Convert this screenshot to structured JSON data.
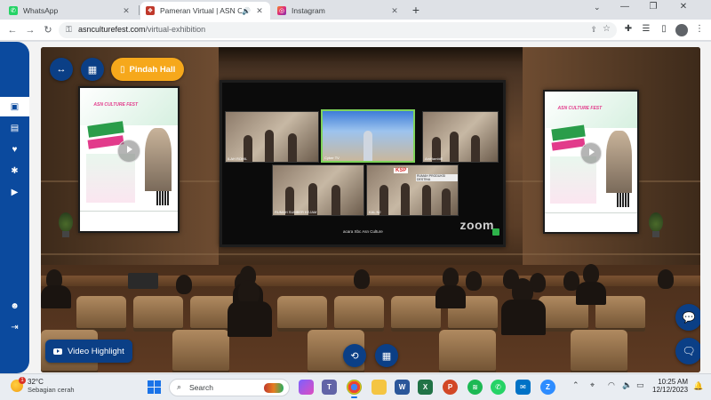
{
  "browser": {
    "tabs": [
      {
        "label": "WhatsApp",
        "favicon_color": "#25d366"
      },
      {
        "label": "Pameran Virtual | ASN Cultu",
        "favicon_color": "#c0392b",
        "active": true
      },
      {
        "label": "Instagram",
        "favicon_color": "#e1306c"
      }
    ],
    "new_tab": "+",
    "url_domain": "asnculturefest.com",
    "url_path": "/virtual-exhibition"
  },
  "exhibition": {
    "pindah_hall_label": "Pindah Hall",
    "video_highlight_label": "Video Highlight",
    "poster_title": "ASN CULTURE FEST",
    "zoom_brand": "zoom",
    "zoom_caption": "acara Xbc Asn Culture",
    "video_tiles": [
      {
        "caption": "ILAH ROHIL"
      },
      {
        "caption": "Cyber TV"
      },
      {
        "caption": "AmHambiE"
      },
      {
        "caption": "RUMAH SUMBER KEJAM"
      },
      {
        "caption": "KAL N2"
      }
    ],
    "tile_signs": [
      "KSP",
      "RUMAH PRODUKSI DESTINA"
    ]
  },
  "sidebar": {
    "items": [
      {
        "name": "exhibition",
        "icon": "store-icon"
      },
      {
        "name": "map",
        "icon": "map-icon"
      },
      {
        "name": "favorite",
        "icon": "heart-icon"
      },
      {
        "name": "settings",
        "icon": "gear-icon"
      },
      {
        "name": "video",
        "icon": "play-icon"
      },
      {
        "name": "user",
        "icon": "user-icon"
      },
      {
        "name": "logout",
        "icon": "logout-icon"
      }
    ]
  },
  "taskbar": {
    "temperature": "32°C",
    "condition": "Sebagian cerah",
    "weather_badge": "1",
    "search_label": "Search",
    "time": "10:25 AM",
    "date": "12/12/2023"
  },
  "colors": {
    "brand_blue": "#0b3f86",
    "accent_orange": "#f6a81b"
  }
}
